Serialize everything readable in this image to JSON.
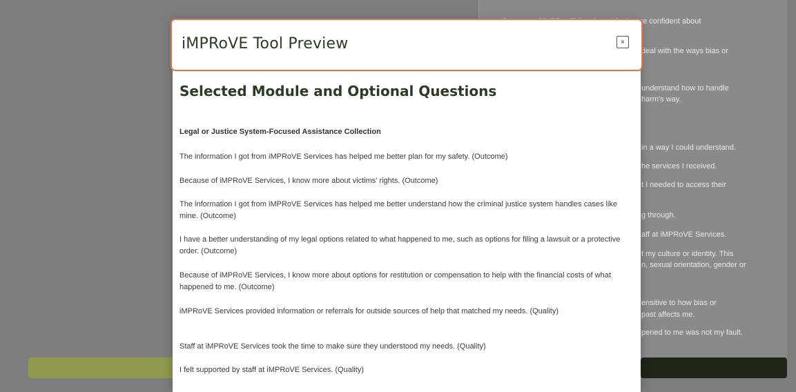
{
  "background": {
    "lines": [
      "Because of iMPRoVE Services, I feel more confident about",
      "deal with the ways bias or",
      "understand how to handle",
      "harm's way.",
      "in a way I could understand.",
      "he services I received.",
      "t I needed to access their",
      "g through.",
      "aff at iMPRoVE Services.",
      "t my culture or identity. This",
      "n, sexual orientation, gender or",
      "ensitive to how bias or",
      "past affects me.",
      "pened to me was not my fault."
    ]
  },
  "modal": {
    "title": "iMPRoVE Tool Preview",
    "close_label": "×",
    "section_title": "Selected Module and Optional Questions",
    "module_name": "Legal or Justice System-Focused Assistance Collection",
    "questions": [
      "The information I got from iMPRoVE Services has helped me better plan for my safety. (Outcome)",
      "Because of iMPRoVE Services, I know more about victims' rights. (Outcome)",
      "The information I got from iMPRoVE Services has helped me better understand how the criminal justice system handles cases like mine. (Outcome)",
      "I have a better understanding of my legal options related to what happened to me, such as options for filing a lawsuit or a protective order. (Outcome)",
      "Because of iMPRoVE Services, I know more about options for restitution or compensation to help with the financial costs of what happened to me. (Outcome)",
      "iMPRoVE Services provided information or referrals for outside sources of help that matched my needs. (Quality)",
      "Staff at iMPRoVE Services took the time to make sure they understood my needs. (Quality)",
      "I felt supported by staff at iMPRoVE Services. (Quality)"
    ]
  },
  "colors": {
    "overlay": "#7d7d7d",
    "header_border": "#e2774f",
    "title_text": "#2c3a26",
    "left_bar": "#8f9a4e",
    "right_bar": "#1d2618"
  }
}
